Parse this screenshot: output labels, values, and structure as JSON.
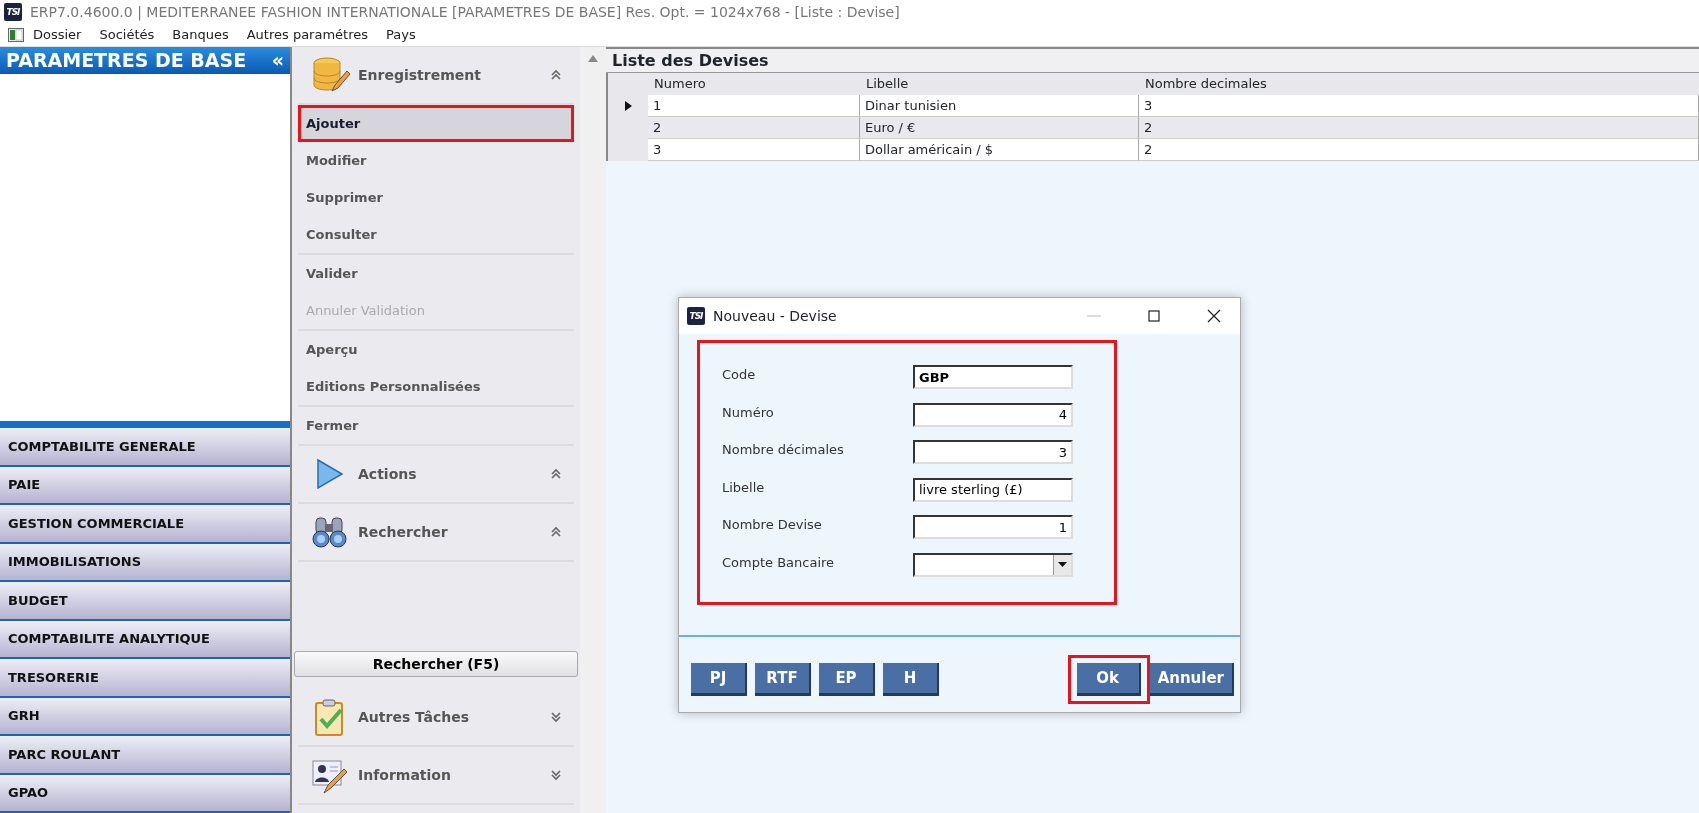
{
  "window": {
    "icon_text": "TSI",
    "title": "ERP7.0.4600.0 | MEDITERRANEE FASHION INTERNATIONALE [PARAMETRES DE BASE] Res. Opt. = 1024x768 - [Liste : Devise]"
  },
  "menu_bar": [
    "Dossier",
    "Sociétés",
    "Banques",
    "Autres paramétres",
    "Pays"
  ],
  "sidebar": {
    "title": "PARAMETRES DE BASE",
    "collapse_glyph": "«",
    "modules": [
      {
        "label": "COMPTABILITE GENERALE",
        "selected": false
      },
      {
        "label": "PAIE",
        "selected": false
      },
      {
        "label": "GESTION COMMERCIALE",
        "selected": false
      },
      {
        "label": "IMMOBILISATIONS",
        "selected": false
      },
      {
        "label": "BUDGET",
        "selected": false
      },
      {
        "label": "COMPTABILITE ANALYTIQUE",
        "selected": false
      },
      {
        "label": "TRESORERIE",
        "selected": false
      },
      {
        "label": "GRH",
        "selected": false
      },
      {
        "label": "PARC ROULANT",
        "selected": false
      },
      {
        "label": "GPAO",
        "selected": false
      }
    ]
  },
  "task_panel": {
    "sections": [
      {
        "title": "Enregistrement",
        "expanded": true,
        "groups": [
          [
            {
              "label": "Ajouter",
              "selected": true,
              "disabled": false,
              "highlighted": true
            },
            {
              "label": "Modifier",
              "selected": false,
              "disabled": false,
              "highlighted": false
            },
            {
              "label": "Supprimer",
              "selected": false,
              "disabled": false,
              "highlighted": false
            },
            {
              "label": "Consulter",
              "selected": false,
              "disabled": false,
              "highlighted": false
            }
          ],
          [
            {
              "label": "Valider",
              "selected": false,
              "disabled": false,
              "highlighted": false
            },
            {
              "label": "Annuler Validation",
              "selected": false,
              "disabled": true,
              "highlighted": false
            }
          ],
          [
            {
              "label": "Aperçu",
              "selected": false,
              "disabled": false,
              "highlighted": false
            },
            {
              "label": "Editions Personnalisées",
              "selected": false,
              "disabled": false,
              "highlighted": false
            }
          ],
          [
            {
              "label": "Fermer",
              "selected": false,
              "disabled": false,
              "highlighted": false
            }
          ]
        ]
      },
      {
        "title": "Actions",
        "expanded": true
      },
      {
        "title": "Rechercher",
        "expanded": true
      },
      {
        "kind": "button",
        "label": "Rechercher (F5)"
      },
      {
        "title": "Autres Tâches",
        "expanded": false
      },
      {
        "title": "Information",
        "expanded": false
      }
    ]
  },
  "table": {
    "title": "Liste des Devises",
    "columns": [
      "Numero",
      "Libelle",
      "Nombre decimales"
    ],
    "rows": [
      {
        "cells": [
          "1",
          "Dinar tunisien",
          "3"
        ],
        "current": true
      },
      {
        "cells": [
          "2",
          "Euro / €",
          "2"
        ],
        "current": false
      },
      {
        "cells": [
          "3",
          "Dollar américain / $",
          "2"
        ],
        "current": false
      }
    ]
  },
  "dialog": {
    "icon_text": "TSI",
    "title": "Nouveau - Devise",
    "fields_highlighted": true,
    "fields": [
      {
        "label": "Code",
        "kind": "code",
        "value": "GBP"
      },
      {
        "label": "Numéro",
        "kind": "number",
        "value": "4"
      },
      {
        "label": "Nombre décimales",
        "kind": "number",
        "value": "3"
      },
      {
        "label": "Libelle",
        "kind": "text",
        "value": "livre sterling (£)"
      },
      {
        "label": "Nombre Devise",
        "kind": "number",
        "value": "1"
      },
      {
        "label": "Compte Bancaire",
        "kind": "combo"
      }
    ],
    "left_buttons": [
      {
        "label": "PJ",
        "highlighted": false
      },
      {
        "label": "RTF",
        "highlighted": false
      },
      {
        "label": "EP",
        "highlighted": false
      },
      {
        "label": "H",
        "highlighted": false
      }
    ],
    "right_buttons": [
      {
        "label": "Ok",
        "highlighted": true
      },
      {
        "label": "Annuler",
        "highlighted": false
      }
    ]
  }
}
